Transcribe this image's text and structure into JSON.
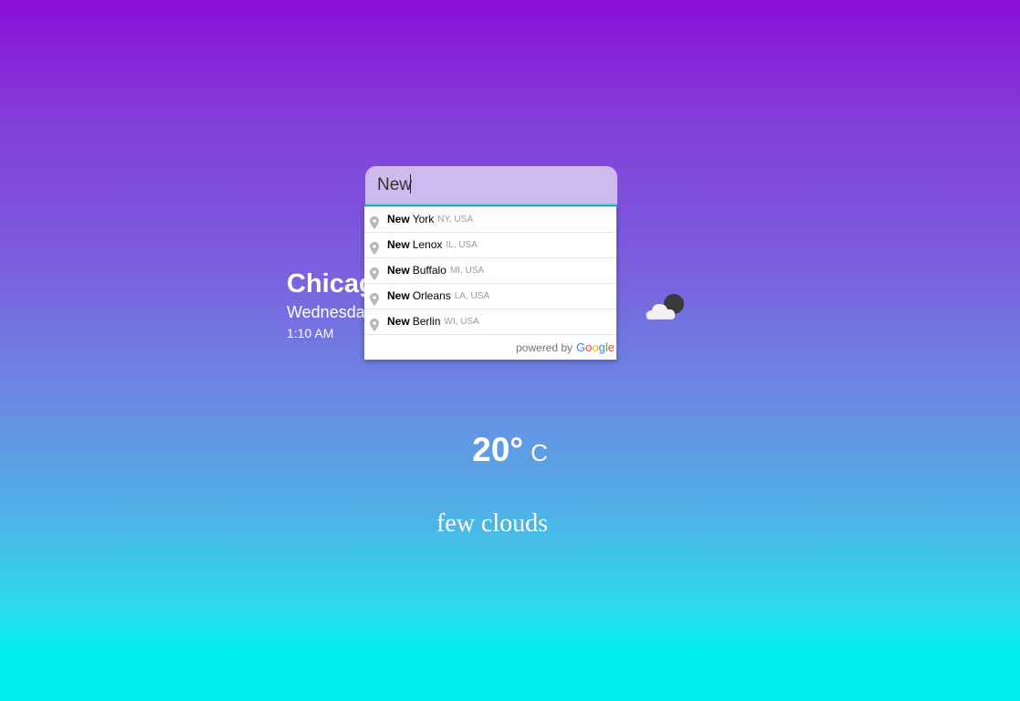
{
  "location": {
    "city": "Chicago",
    "date": "Wednesday",
    "time": "1:10 AM"
  },
  "weather": {
    "icon": "cloud-moon-icon",
    "temperature": "20°",
    "unit": "C",
    "description": "few clouds"
  },
  "search": {
    "value": "New",
    "placeholder": ""
  },
  "suggestions": [
    {
      "match": "New",
      "rest": "York",
      "secondary": "NY, USA"
    },
    {
      "match": "New",
      "rest": "Lenox",
      "secondary": "IL, USA"
    },
    {
      "match": "New",
      "rest": "Buffalo",
      "secondary": "MI, USA"
    },
    {
      "match": "New",
      "rest": "Orleans",
      "secondary": "LA, USA"
    },
    {
      "match": "New",
      "rest": "Berlin",
      "secondary": "WI, USA"
    }
  ],
  "attribution": {
    "powered_by": "powered by",
    "brand": "Google"
  },
  "colors": {
    "gradient_top": "#8a0fd6",
    "gradient_bottom": "#00eef0",
    "input_bg": "#cfbaf0",
    "input_border": "#2ee0f0"
  }
}
